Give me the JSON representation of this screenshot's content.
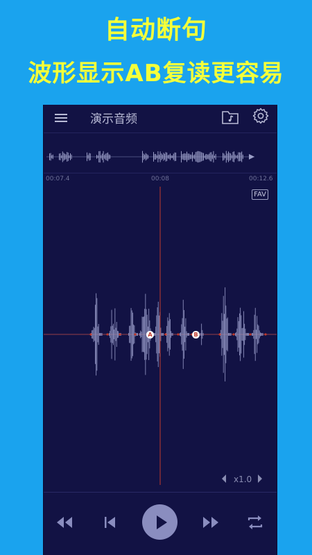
{
  "promo": {
    "line1": "自动断句",
    "line2": "波形显示AB复读更容易"
  },
  "app": {
    "title": "演示音频",
    "icons": {
      "menu": "hamburger-menu-icon",
      "folder": "music-folder-icon",
      "settings": "gear-icon"
    }
  },
  "timeline": {
    "start": "00:07.4",
    "mid": "00:08",
    "end": "00:12.6"
  },
  "waveform": {
    "fav_label": "FAV",
    "marker_a": "A",
    "marker_b": "B"
  },
  "playback": {
    "speed_label": "x1.0",
    "state": "paused"
  },
  "colors": {
    "background": "#1aa3ee",
    "headline": "#f4ff3a",
    "panel": "#121244",
    "waveform": "#8c8fbd",
    "cursor": "#c0392b",
    "play_button": "#8a8dbf"
  }
}
